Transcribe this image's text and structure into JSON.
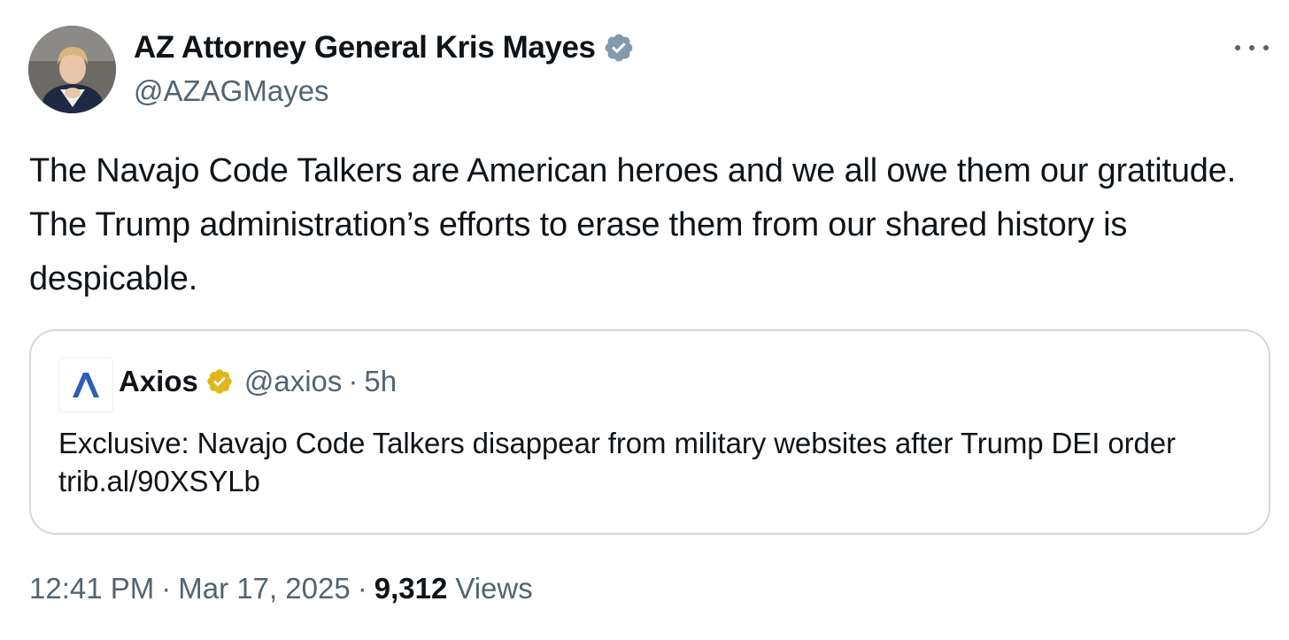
{
  "author": {
    "display_name": "AZ Attorney General Kris Mayes",
    "handle": "@AZAGMayes",
    "verified_badge": "verified-badge-gray",
    "badge_color": "#829aab"
  },
  "more_menu": {
    "icon": "more-horizontal-icon"
  },
  "tweet": {
    "text": "The Navajo Code Talkers are American heroes and we all owe them our gratitude. The Trump administration’s efforts to erase them from our shared history is despicable."
  },
  "quote": {
    "logo_icon": "axios-logo-icon",
    "name": "Axios",
    "verified_badge": "verified-badge-gold",
    "badge_color": "#e2b719",
    "handle": "@axios",
    "separator": "·",
    "time": "5h",
    "text": "Exclusive: Navajo Code Talkers disappear from military websites after Trump DEI order trib.al/90XSYLb"
  },
  "meta": {
    "time": "12:41 PM",
    "separator": "·",
    "date": "Mar 17, 2025",
    "views_count": "9,312",
    "views_label": "Views"
  },
  "colors": {
    "text_primary": "#0f1419",
    "text_secondary": "#536471",
    "border": "#cfd9de",
    "axios_blue": "#2b5fb3"
  }
}
